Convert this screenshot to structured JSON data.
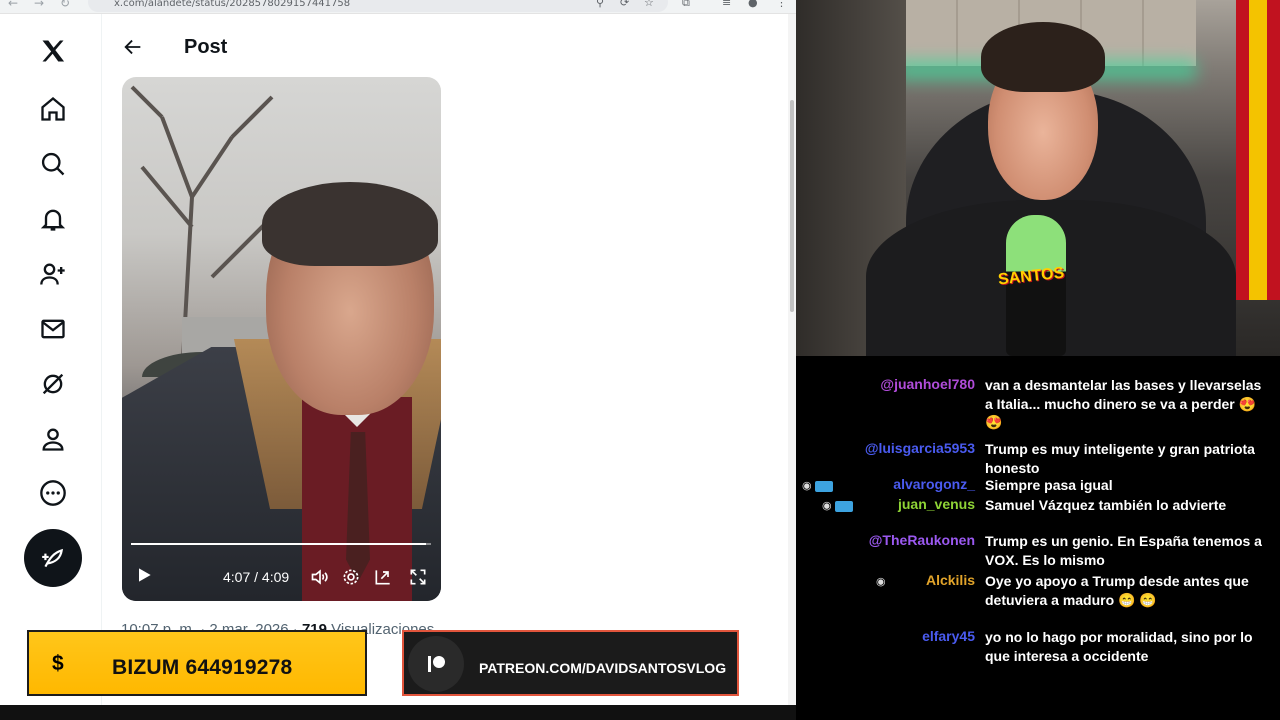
{
  "browser": {
    "url": "x.com/alandete/status/2028578029157441758",
    "post_title": "Post",
    "video": {
      "time": "4:07 / 4:09",
      "progress_fraction": 0.984
    },
    "meta": {
      "date": "10:07 p. m. · 2 mar. 2026 ·",
      "views_count": "719",
      "views_label": "Visualizaciones"
    }
  },
  "banners": {
    "bizum_symbol": "$",
    "bizum_text": "BIZUM 644919278",
    "patreon_text": "PATREON.COM/DAVIDSANTOSVLOG"
  },
  "webcam": {
    "mic_label": "SANTOS"
  },
  "chat": {
    "messages": [
      {
        "user": "@juanhoel780",
        "color": "#b04cd9",
        "text": "van a desmantelar las bases y llevarselas a Italia... mucho dinero se va a perder 😍 😍"
      },
      {
        "user": "@luisgarcia5953",
        "color": "#4a5bf0",
        "text": "Trump es muy inteligente y gran patriota honesto"
      },
      {
        "user": "alvarogonz_",
        "color": "#4a5bf0",
        "text": "Siempre pasa igual"
      },
      {
        "user": "juan_venus",
        "color": "#8fd436",
        "text": "Samuel Vázquez también lo advierte"
      },
      {
        "user": "@TheRaukonen",
        "color": "#9b59f0",
        "text": "Trump es un genio. En España tenemos a VOX. Es lo mismo"
      },
      {
        "user": "Alckilis",
        "color": "#e2a42a",
        "text": "Oye yo apoyo a Trump desde antes que detuviera a maduro 😁 😁"
      },
      {
        "user": "elfary45",
        "color": "#4a5bf0",
        "text": "yo no lo hago por moralidad, sino por lo que interesa a occidente"
      }
    ]
  }
}
